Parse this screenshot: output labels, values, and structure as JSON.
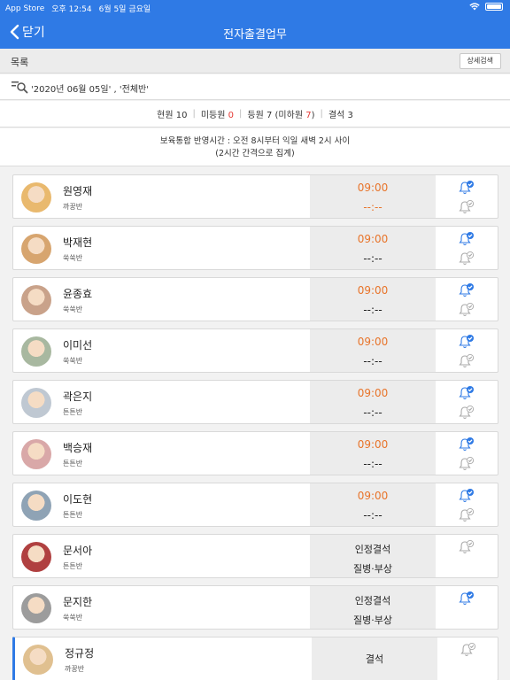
{
  "statusbar": {
    "carrier": "App Store",
    "time": "오후 12:54",
    "date": "6월 5일 금요일"
  },
  "nav": {
    "back_label": "닫기",
    "title": "전자출결업무"
  },
  "listbar": {
    "title": "목록",
    "detail_button": "상세검색"
  },
  "search": {
    "query": "'2020년 06월 05일' , '전체반'"
  },
  "stats": {
    "current_label": "현원",
    "current_value": "10",
    "unregistered_label": "미등원",
    "unregistered_value": "0",
    "registered_label": "등원",
    "registered_value": "7",
    "not_departed_label": "(미하원",
    "not_departed_value": "7",
    "not_departed_suffix": ")",
    "absent_label": "결석",
    "absent_value": "3"
  },
  "notice": {
    "line1": "보육통합 반영시간 : 오전 8시부터 익일 새벽 2시 사이",
    "line2": "(2시간 간격으로 집계)"
  },
  "children": [
    {
      "name": "원영재",
      "class": "까꿍반",
      "in": "09:00",
      "out": "--:--",
      "out_orange": true,
      "bell_top": true,
      "bell_bottom": true,
      "avatar_color": "#e9b96e",
      "active": false
    },
    {
      "name": "박재현",
      "class": "쑥쑥반",
      "in": "09:00",
      "out": "--:--",
      "out_orange": false,
      "bell_top": true,
      "bell_bottom": true,
      "avatar_color": "#d7a56f",
      "active": false
    },
    {
      "name": "윤종효",
      "class": "쑥쑥반",
      "in": "09:00",
      "out": "--:--",
      "out_orange": false,
      "bell_top": true,
      "bell_bottom": true,
      "avatar_color": "#c9a28a",
      "active": false
    },
    {
      "name": "이미선",
      "class": "쑥쑥반",
      "in": "09:00",
      "out": "--:--",
      "out_orange": false,
      "bell_top": true,
      "bell_bottom": true,
      "avatar_color": "#a8b8a0",
      "active": false
    },
    {
      "name": "곽은지",
      "class": "튼튼반",
      "in": "09:00",
      "out": "--:--",
      "out_orange": false,
      "bell_top": true,
      "bell_bottom": true,
      "avatar_color": "#bfc8d2",
      "active": false
    },
    {
      "name": "백승재",
      "class": "튼튼반",
      "in": "09:00",
      "out": "--:--",
      "out_orange": false,
      "bell_top": true,
      "bell_bottom": true,
      "avatar_color": "#d9a8a8",
      "active": false
    },
    {
      "name": "이도현",
      "class": "튼튼반",
      "in": "09:00",
      "out": "--:--",
      "out_orange": false,
      "bell_top": true,
      "bell_bottom": true,
      "avatar_color": "#8fa3b5",
      "active": false
    },
    {
      "name": "문서아",
      "class": "튼튼반",
      "status1": "인정결석",
      "status2": "질병·부상",
      "bell_top": false,
      "bell_bottom": false,
      "bell_top_grey": true,
      "avatar_color": "#b04040",
      "active": false
    },
    {
      "name": "문지한",
      "class": "쑥쑥반",
      "status1": "인정결석",
      "status2": "질병·부상",
      "bell_top": true,
      "bell_bottom": false,
      "avatar_color": "#9c9c9c",
      "active": false
    },
    {
      "name": "정규정",
      "class": "까꿍반",
      "status_single": "결석",
      "bell_top": false,
      "bell_bottom": false,
      "bell_top_grey": true,
      "avatar_color": "#e0c090",
      "active": true
    }
  ],
  "colors": {
    "brand": "#2f7ae5",
    "time_in": "#e8742a",
    "highlight_red": "#e53935"
  }
}
